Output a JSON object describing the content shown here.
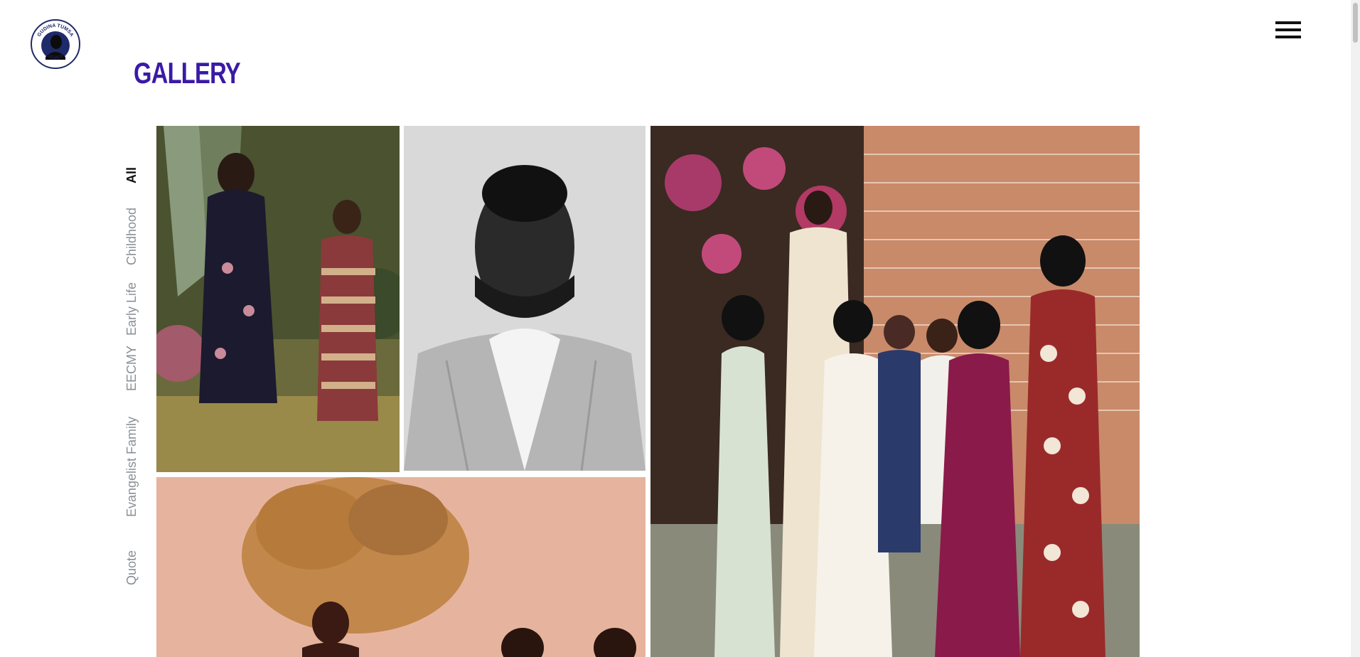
{
  "logo": {
    "text_top": "GUDINA TUMSA",
    "text_bottom": "LEGACY"
  },
  "header": {
    "title": "GALLERY"
  },
  "filters": [
    {
      "label": "All",
      "active": true
    },
    {
      "label": "Childhood",
      "active": false
    },
    {
      "label": "Early Life",
      "active": false
    },
    {
      "label": "EECMY",
      "active": false
    },
    {
      "label": "Evangelist Family",
      "active": false
    },
    {
      "label": "Quote",
      "active": false
    }
  ],
  "gallery": {
    "photos": [
      {
        "name": "photo-mother-and-daughter-garden"
      },
      {
        "name": "photo-portrait-man-black-white"
      },
      {
        "name": "photo-family-group-brick-wall"
      },
      {
        "name": "photo-group-outdoors-tree"
      }
    ]
  },
  "colors": {
    "title": "#3a1aa6",
    "filter_inactive": "#8a8f96",
    "filter_active": "#111111"
  },
  "icons": {
    "menu": "hamburger-icon"
  }
}
